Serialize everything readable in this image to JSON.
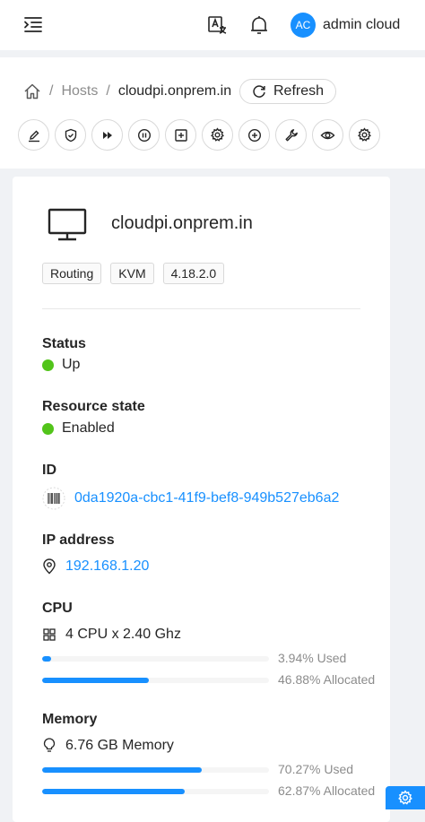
{
  "topbar": {
    "menu_icon": "menu-unfold-icon",
    "translate_icon": "translate-icon",
    "bell_icon": "bell-icon",
    "avatar_initials": "AC",
    "user_name": "admin cloud"
  },
  "breadcrumb": {
    "home_icon": "home-icon",
    "separator": "/",
    "items": [
      "Hosts",
      "cloudpi.onprem.in"
    ]
  },
  "refresh_label": "Refresh",
  "actions": [
    "edit-icon",
    "shield-check-icon",
    "fast-forward-icon",
    "pause-circle-icon",
    "plus-square-icon",
    "gear-icon",
    "plus-circle-icon",
    "tool-icon",
    "eye-icon",
    "gear-icon"
  ],
  "host": {
    "name": "cloudpi.onprem.in",
    "tags": [
      "Routing",
      "KVM",
      "4.18.2.0"
    ]
  },
  "status": {
    "title": "Status",
    "value": "Up",
    "color": "#52c41a"
  },
  "resource_state": {
    "title": "Resource state",
    "value": "Enabled",
    "color": "#52c41a"
  },
  "id": {
    "title": "ID",
    "value": "0da1920a-cbc1-41f9-bef8-949b527eb6a2"
  },
  "ip": {
    "title": "IP address",
    "value": "192.168.1.20"
  },
  "cpu": {
    "title": "CPU",
    "value": "4 CPU x 2.40 Ghz",
    "used_label": "3.94% Used",
    "used_fraction": 0.0394,
    "allocated_label": "46.88% Allocated",
    "allocated_fraction": 0.4688
  },
  "memory": {
    "title": "Memory",
    "value": "6.76 GB Memory",
    "used_label": "70.27% Used",
    "used_fraction": 0.7027,
    "allocated_label": "62.87% Allocated",
    "allocated_fraction": 0.6287
  },
  "colors": {
    "accent": "#1890ff",
    "success": "#52c41a"
  }
}
